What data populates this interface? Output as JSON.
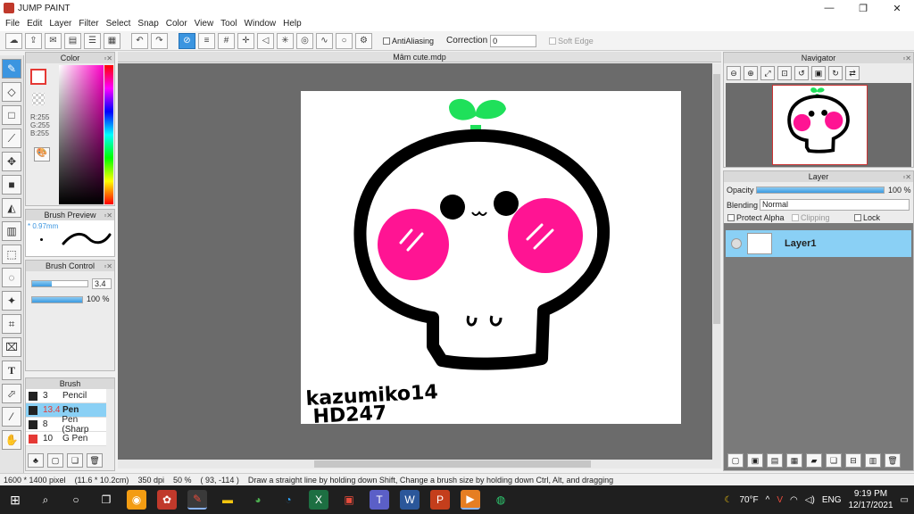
{
  "app": {
    "title": "JUMP PAINT",
    "win_min": "—",
    "win_max": "❐",
    "win_close": "✕"
  },
  "menu": [
    "File",
    "Edit",
    "Layer",
    "Filter",
    "Select",
    "Snap",
    "Color",
    "View",
    "Tool",
    "Window",
    "Help"
  ],
  "toolbar": {
    "antialiasing": "AntiAliasing",
    "correction_label": "Correction",
    "correction_value": "0",
    "soft_edge": "Soft Edge"
  },
  "document": {
    "tab_title": "Mâm cute.mdp"
  },
  "color_panel": {
    "title": "Color",
    "r": "R:255",
    "g": "G:255",
    "b": "B:255"
  },
  "brush_preview": {
    "title": "Brush Preview",
    "size": "* 0.97mm"
  },
  "brush_control": {
    "title": "Brush Control",
    "size_value": "3.4",
    "opacity_value": "100 %",
    "size_fraction": 0.35,
    "opacity_fraction": 1.0
  },
  "brush": {
    "title": "Brush",
    "items": [
      {
        "size": "3",
        "name": "Pencil",
        "color": "#222222"
      },
      {
        "size": "13.4",
        "name": "Pen",
        "color": "#222222",
        "selected": true
      },
      {
        "size": "8",
        "name": "Pen (Sharp",
        "color": "#222222"
      },
      {
        "size": "10",
        "name": "G Pen",
        "color": "#e53935"
      }
    ]
  },
  "navigator": {
    "title": "Navigator"
  },
  "layer_panel": {
    "title": "Layer",
    "opacity_label": "Opacity",
    "opacity_value": "100 %",
    "opacity_fraction": 1.0,
    "blending_label": "Blending",
    "blending_value": "Normal",
    "protect_alpha": "Protect Alpha",
    "clipping": "Clipping",
    "lock": "Lock",
    "layer_name": "Layer1"
  },
  "artwork": {
    "signature_line1": "kazumiko14",
    "signature_line2": "HD247"
  },
  "status": {
    "image_size": "1600 * 1400 pixel",
    "physical_size": "(11.6 * 10.2cm)",
    "dpi": "350 dpi",
    "zoom": "50 %",
    "coords": "( 93, -114 )",
    "hint": "Draw a straight line by holding down Shift, Change a brush size by holding down Ctrl, Alt, and dragging"
  },
  "taskbar": {
    "weather": "70°F",
    "language": "ENG",
    "time": "9:19 PM",
    "date": "12/17/2021"
  },
  "colors": {
    "accent": "#3b95e0",
    "selected_row": "#8ad0f5",
    "workspace": "#6b6b6b",
    "blush": "#ff1493",
    "sprout": "#1fe05a"
  }
}
